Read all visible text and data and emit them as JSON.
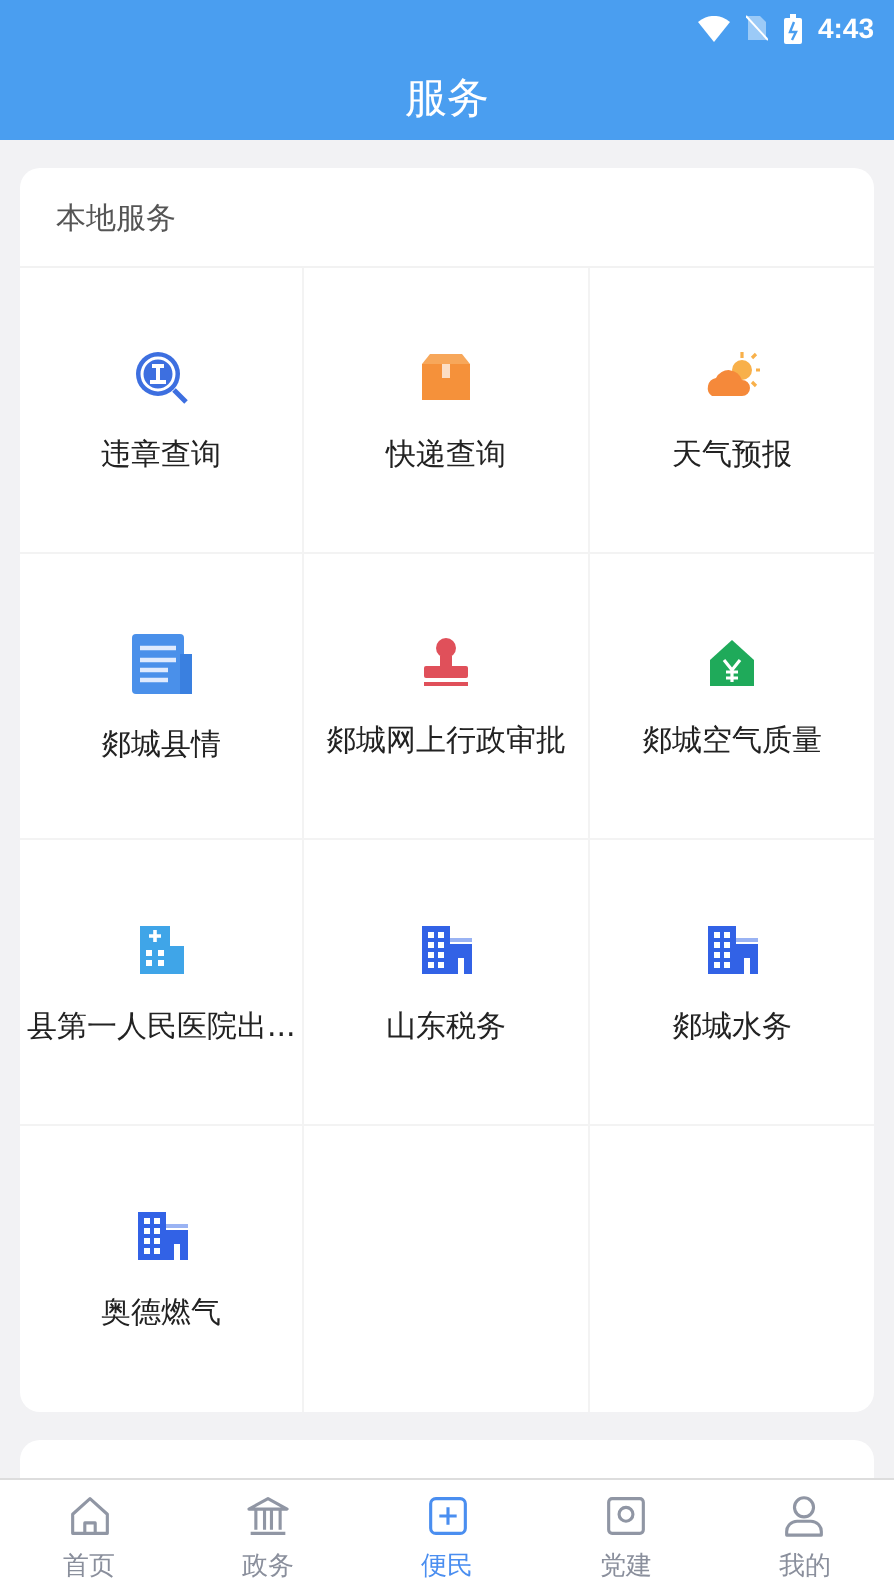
{
  "status_bar": {
    "time": "4:43"
  },
  "header": {
    "title": "服务"
  },
  "section": {
    "title": "本地服务",
    "items": [
      {
        "label": "违章查询",
        "kind": "violation"
      },
      {
        "label": "快递查询",
        "kind": "parcel"
      },
      {
        "label": "天气预报",
        "kind": "weather"
      },
      {
        "label": "郯城县情",
        "kind": "document"
      },
      {
        "label": "郯城网上行政审批",
        "kind": "stamp"
      },
      {
        "label": "郯城空气质量",
        "kind": "house"
      },
      {
        "label": "县第一人民医院出...",
        "kind": "hospital"
      },
      {
        "label": "山东税务",
        "kind": "building"
      },
      {
        "label": "郯城水务",
        "kind": "building"
      },
      {
        "label": "奥德燃气",
        "kind": "building"
      }
    ]
  },
  "tab_bar": [
    {
      "label": "首页",
      "kind": "home",
      "selected": false
    },
    {
      "label": "政务",
      "kind": "government",
      "selected": false
    },
    {
      "label": "便民",
      "kind": "service",
      "selected": true
    },
    {
      "label": "党建",
      "kind": "party",
      "selected": false
    },
    {
      "label": "我的",
      "kind": "profile",
      "selected": false
    }
  ]
}
